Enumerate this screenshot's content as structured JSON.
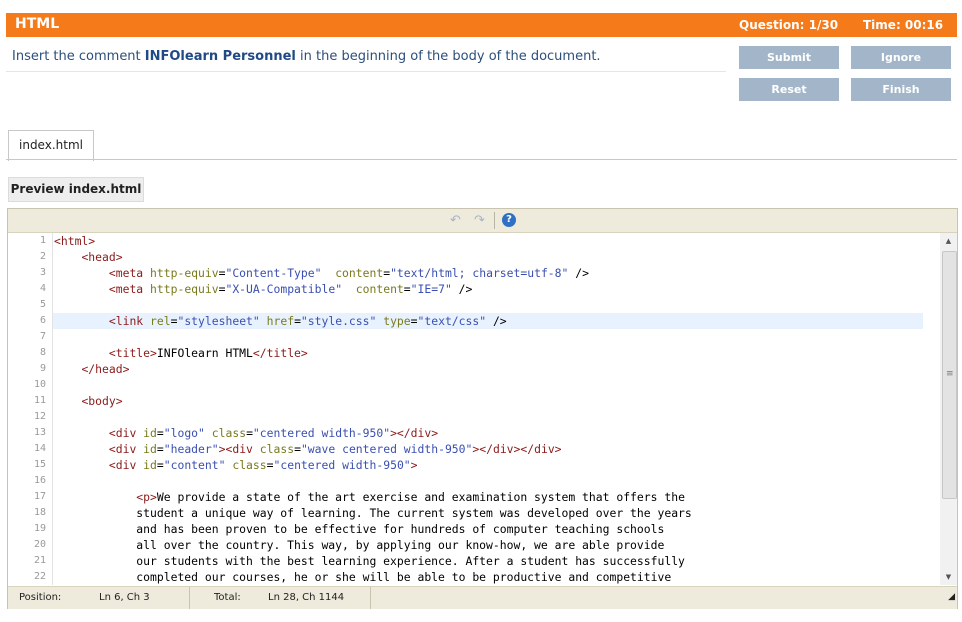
{
  "header": {
    "title": "HTML",
    "question": "Question: 1/30",
    "time": "Time: 00:16",
    "bg_color": "#f47a1a"
  },
  "instruction": {
    "prefix": "Insert the comment ",
    "highlight": "INFOlearn Personnel",
    "suffix": " in the beginning of the body of the document."
  },
  "buttons": {
    "submit": "Submit",
    "ignore": "Ignore",
    "reset": "Reset",
    "finish": "Finish",
    "color": "#a2b5c9"
  },
  "tabs": [
    "index.html"
  ],
  "preview_button": "Preview index.html",
  "toolbar_icons": [
    "undo-icon",
    "redo-icon",
    "help-icon"
  ],
  "editor": {
    "active_line": 6,
    "lines": [
      [
        [
          "tg",
          "<html>"
        ]
      ],
      [
        [
          "",
          "    "
        ],
        [
          "tg",
          "<head>"
        ]
      ],
      [
        [
          "",
          "        "
        ],
        [
          "tg",
          "<meta "
        ],
        [
          "at",
          "http-equiv"
        ],
        [
          "",
          "="
        ],
        [
          "vl",
          "\"Content-Type\""
        ],
        [
          "",
          "  "
        ],
        [
          "at",
          "content"
        ],
        [
          "",
          "="
        ],
        [
          "vl",
          "\"text/html; charset=utf-8\""
        ],
        [
          "",
          " />"
        ]
      ],
      [
        [
          "",
          "        "
        ],
        [
          "tg",
          "<meta "
        ],
        [
          "at",
          "http-equiv"
        ],
        [
          "",
          "="
        ],
        [
          "vl",
          "\"X-UA-Compatible\""
        ],
        [
          "",
          "  "
        ],
        [
          "at",
          "content"
        ],
        [
          "",
          "="
        ],
        [
          "vl",
          "\"IE=7\""
        ],
        [
          "",
          " />"
        ]
      ],
      [],
      [
        [
          "",
          "        "
        ],
        [
          "tg",
          "<link "
        ],
        [
          "at",
          "rel"
        ],
        [
          "",
          "="
        ],
        [
          "vl",
          "\"stylesheet\""
        ],
        [
          "",
          " "
        ],
        [
          "at",
          "href"
        ],
        [
          "",
          "="
        ],
        [
          "vl",
          "\"style.css\""
        ],
        [
          "",
          " "
        ],
        [
          "at",
          "type"
        ],
        [
          "",
          "="
        ],
        [
          "vl",
          "\"text/css\""
        ],
        [
          "",
          " />"
        ]
      ],
      [],
      [
        [
          "",
          "        "
        ],
        [
          "tg",
          "<title>"
        ],
        [
          "",
          "INFOlearn HTML"
        ],
        [
          "tg",
          "</title>"
        ]
      ],
      [
        [
          "",
          "    "
        ],
        [
          "tg",
          "</head>"
        ]
      ],
      [],
      [
        [
          "",
          "    "
        ],
        [
          "tg",
          "<body>"
        ]
      ],
      [],
      [
        [
          "",
          "        "
        ],
        [
          "tg",
          "<div "
        ],
        [
          "at",
          "id"
        ],
        [
          "",
          "="
        ],
        [
          "vl",
          "\"logo\""
        ],
        [
          "",
          " "
        ],
        [
          "at",
          "class"
        ],
        [
          "",
          "="
        ],
        [
          "vl",
          "\"centered width-950\""
        ],
        [
          "tg",
          "></div>"
        ]
      ],
      [
        [
          "",
          "        "
        ],
        [
          "tg",
          "<div "
        ],
        [
          "at",
          "id"
        ],
        [
          "",
          "="
        ],
        [
          "vl",
          "\"header\""
        ],
        [
          "tg",
          "><div "
        ],
        [
          "at",
          "class"
        ],
        [
          "",
          "="
        ],
        [
          "vl",
          "\"wave centered width-950\""
        ],
        [
          "tg",
          "></div></div>"
        ]
      ],
      [
        [
          "",
          "        "
        ],
        [
          "tg",
          "<div "
        ],
        [
          "at",
          "id"
        ],
        [
          "",
          "="
        ],
        [
          "vl",
          "\"content\""
        ],
        [
          "",
          " "
        ],
        [
          "at",
          "class"
        ],
        [
          "",
          "="
        ],
        [
          "vl",
          "\"centered width-950\""
        ],
        [
          "tg",
          ">"
        ]
      ],
      [],
      [
        [
          "",
          "            "
        ],
        [
          "tg",
          "<p>"
        ],
        [
          "",
          "We provide a state of the art exercise and examination system that offers the"
        ]
      ],
      [
        [
          "",
          "            student a unique way of learning. The current system was developed over the years"
        ]
      ],
      [
        [
          "",
          "            and has been proven to be effective for hundreds of computer teaching schools"
        ]
      ],
      [
        [
          "",
          "            all over the country. This way, by applying our know-how, we are able provide"
        ]
      ],
      [
        [
          "",
          "            our students with the best learning experience. After a student has successfully"
        ]
      ],
      [
        [
          "",
          "            completed our courses, he or she will be able to be productive and competitive"
        ]
      ]
    ]
  },
  "status": {
    "position_label": "Position:",
    "position_value": "Ln 6, Ch 3",
    "total_label": "Total:",
    "total_value": "Ln 28, Ch 1144"
  }
}
